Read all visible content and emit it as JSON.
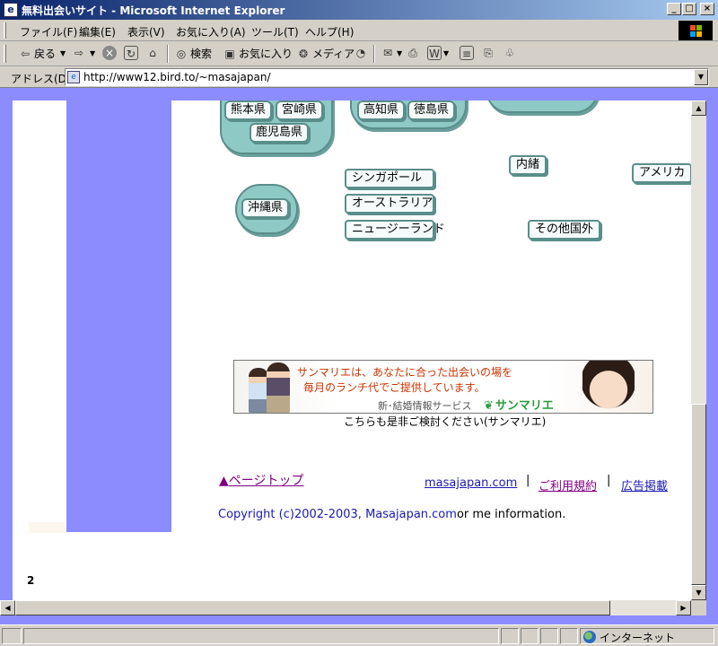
{
  "window": {
    "title": "無料出会いサイト - Microsoft Internet Explorer",
    "controls": {
      "minimize": "_",
      "maximize": "□",
      "close": "×"
    }
  },
  "menu": [
    "ファイル(F)",
    "編集(E)",
    "表示(V)",
    "お気に入り(A)",
    "ツール(T)",
    "ヘルプ(H)"
  ],
  "toolbar": {
    "back": "戻る",
    "search": "検索",
    "favorites": "お気に入り",
    "media": "メディア"
  },
  "address": {
    "label": "アドレス(D)",
    "url": "http://www12.bird.to/~masajapan/"
  },
  "regions": {
    "kyushu": [
      "熊本県",
      "宮崎県",
      "鹿児島県"
    ],
    "shikoku": [
      "高知県",
      "徳島県"
    ],
    "okinawa": "沖縄県"
  },
  "international": {
    "singapore": "シンガポール",
    "australia": "オーストラリア",
    "newzealand": "ニュージーランド",
    "secret": "内緒",
    "america": "アメリカ",
    "other": "その他国外"
  },
  "banner": {
    "line1": "サンマリエは、あなたに合った出会いの場を",
    "line2": "毎月のランチ代でご提供しています。",
    "tagline": "新･結婚情報サービス",
    "logo": "サンマリエ",
    "caption": "こちらも是非ご検討ください(サンマリエ)"
  },
  "footer": {
    "page_top": "ページトップ",
    "page_top_mark": "▲",
    "links": [
      "masajapan.com",
      "ご利用規約",
      "広告掲載"
    ],
    "separator": "|",
    "copyright": "Copyright (c)2002-2003, Masajapan.com",
    "copyright_rest": "or me information."
  },
  "page_number": "2",
  "status": {
    "zone": "インターネット"
  },
  "colors": {
    "frame": "#8c8cff",
    "region_fill": "#8fc9c6",
    "region_border": "#5a8e8a",
    "link_unvisited": "#1a1ab0",
    "link_visited": "#800080"
  }
}
